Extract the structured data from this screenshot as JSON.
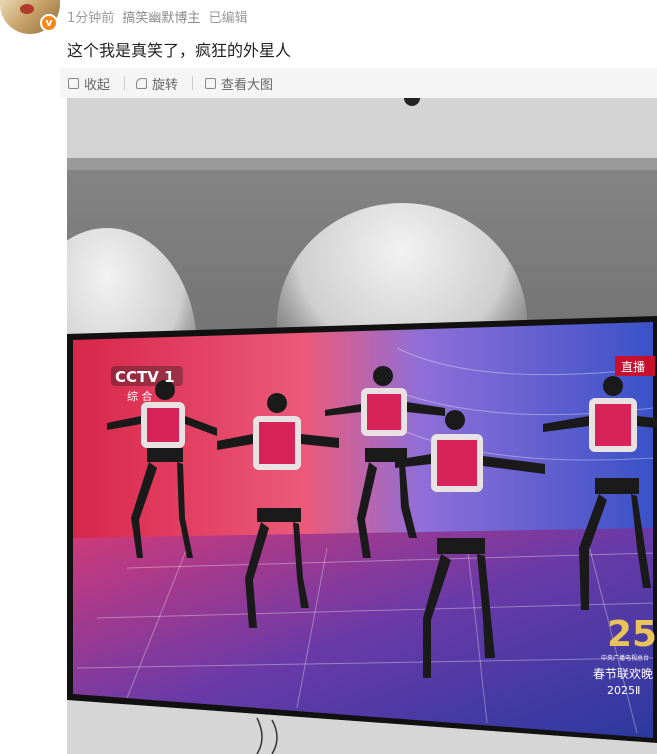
{
  "post": {
    "time": "1分钟前",
    "source": "搞笑幽默博主",
    "edited": "已编辑",
    "text": "这个我是真笑了，疯狂的外星人"
  },
  "toolbar": {
    "collect_label": "收起",
    "rotate_label": "旋转",
    "view_large_label": "查看大图"
  },
  "tv_screen": {
    "channel_logo": "CCTV 1",
    "channel_sub": "综 合",
    "live_badge": "直播",
    "event_logo": "春节联欢晚",
    "event_year": "2025Ⅱ",
    "event_small": "中央广播电视总台"
  },
  "colors": {
    "verified_badge": "#f7861b",
    "live_badge": "#c8102e"
  }
}
